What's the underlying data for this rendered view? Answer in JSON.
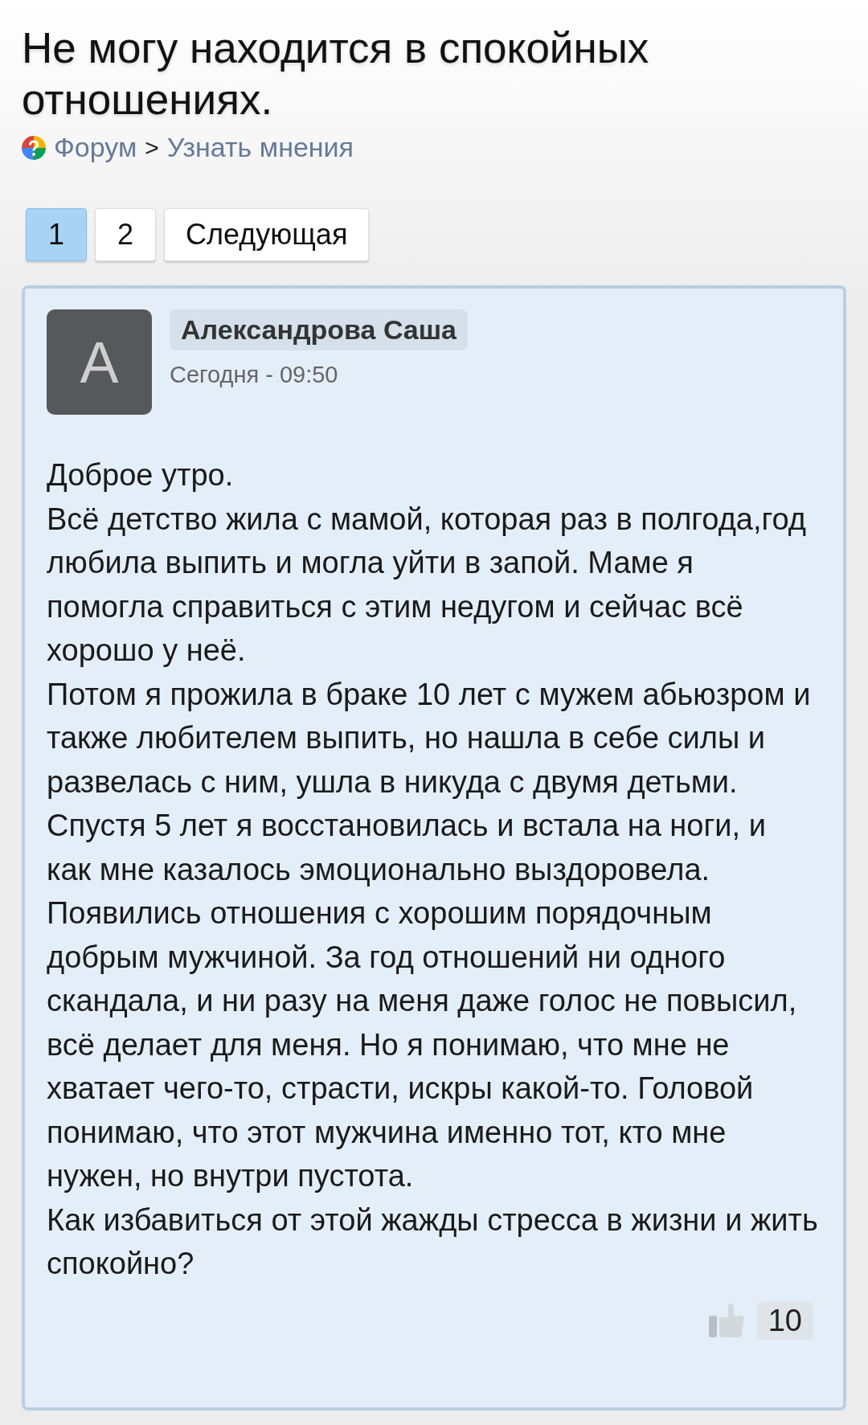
{
  "title": "Не могу находится в спокойных отношениях.",
  "breadcrumb": {
    "items": [
      {
        "label": "Форум"
      },
      {
        "label": "Узнать мнения"
      }
    ],
    "separator": ">"
  },
  "pagination": [
    {
      "label": "1",
      "selected": true
    },
    {
      "label": "2",
      "selected": false
    },
    {
      "label": "Следующая",
      "selected": false
    }
  ],
  "post": {
    "avatar_letter": "А",
    "author": "Александрова Саша",
    "date": "Сегодня - 09:50",
    "paragraphs": [
      "Доброе утро.",
      "Всё детство жила с мамой, которая раз в полгода,год любила выпить и могла уйти в запой. Маме я помогла справиться с этим недугом и сейчас всё хорошо у неё.",
      "Потом я прожила в браке 10 лет с мужем абьюзром и также любителем выпить, но нашла в себе силы и развелась с ним, ушла в никуда с двумя детьми. Спустя 5 лет я восстановилась и встала на ноги, и как мне казалось эмоционально выздоровела.",
      "Появились отношения с хорошим порядочным добрым мужчиной. За год отношений ни одного скандала, и ни разу на меня даже голос не повысил, всё делает для меня. Но я понимаю, что мне не хватает чего-то, страсти, искры какой-то. Головой понимаю, что этот мужчина именно тот, кто мне нужен, но внутри пустота.",
      "Как избавиться от этой жажды стресса в жизни и жить спокойно?"
    ],
    "likes": "10"
  }
}
